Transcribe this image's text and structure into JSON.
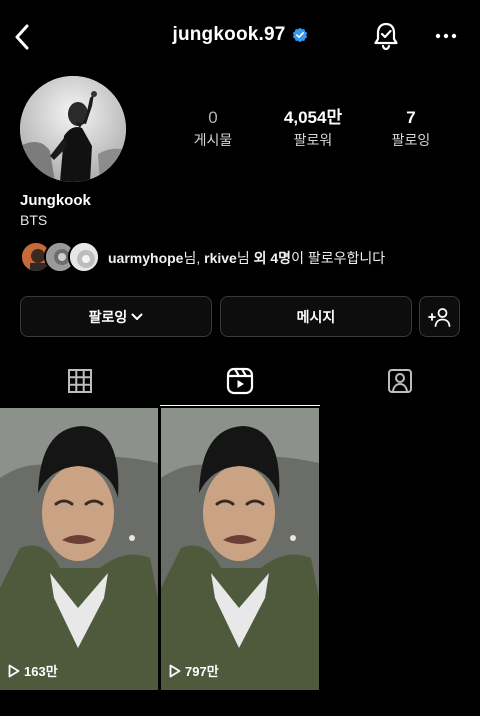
{
  "header": {
    "username": "jungkook.97",
    "verified": true,
    "icons": [
      "back-arrow-icon",
      "verified-badge-icon",
      "notification-bell-icon",
      "more-options-icon"
    ]
  },
  "profile": {
    "display_name": "Jungkook",
    "bio": "BTS",
    "stats": [
      {
        "value": "0",
        "label": "게시물"
      },
      {
        "value": "4,054만",
        "label": "팔로워"
      },
      {
        "value": "7",
        "label": "팔로잉"
      }
    ]
  },
  "followed_by": {
    "user1": "uarmyhope",
    "suffix1": "님, ",
    "user2": "rkive",
    "suffix2": "님 ",
    "others": "외 4명",
    "suffix3": "이 팔로우합니다"
  },
  "actions": {
    "following_label": "팔로잉",
    "message_label": "메시지"
  },
  "tabs": [
    {
      "name": "grid",
      "icon": "grid-icon",
      "active": false
    },
    {
      "name": "reels",
      "icon": "reels-icon",
      "active": true
    },
    {
      "name": "tagged",
      "icon": "tagged-person-icon",
      "active": false
    }
  ],
  "reels": [
    {
      "views": "163만"
    },
    {
      "views": "797만"
    }
  ],
  "colors": {
    "background": "#000000",
    "verified": "#3897f0",
    "button_bg": "#0d0d0d",
    "button_border": "#3a3a3a"
  }
}
